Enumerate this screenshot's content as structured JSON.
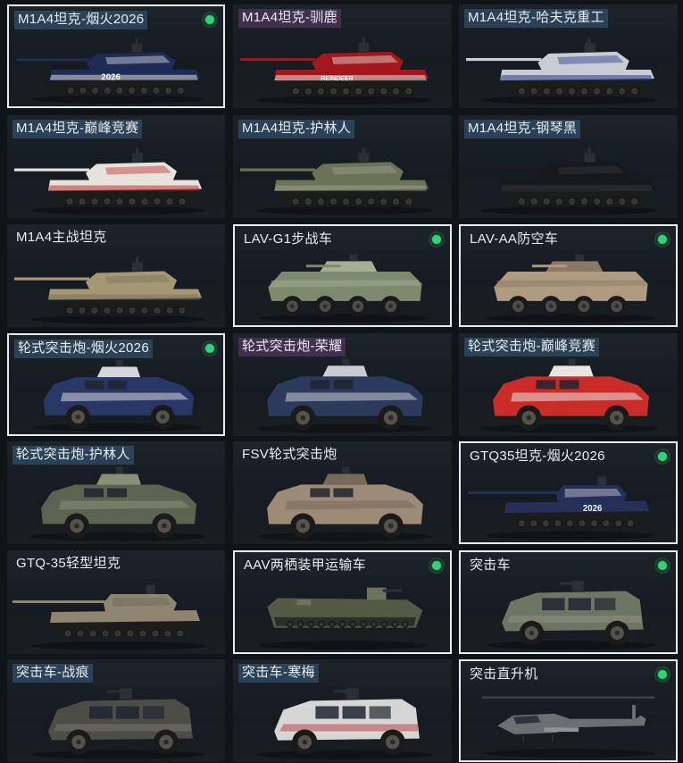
{
  "cards": [
    {
      "label": "M1A4坦克-烟火2026",
      "kind": "tank",
      "selected": true,
      "equipped": true,
      "title_bg": "blue",
      "hull": "#1f2b55",
      "accent": "#d9dbe3",
      "decal": "2026"
    },
    {
      "label": "M1A4坦克-驯鹿",
      "kind": "tank",
      "selected": false,
      "equipped": false,
      "title_bg": "purple",
      "hull": "#a2161c",
      "accent": "#e8e2d8",
      "decal": "REINDEER"
    },
    {
      "label": "M1A4坦克-哈夫克重工",
      "kind": "tank",
      "selected": false,
      "equipped": false,
      "title_bg": "blue",
      "hull": "#c9ccd3",
      "accent": "#2a3a8a",
      "decal": ""
    },
    {
      "label": "M1A4坦克-巅峰竞赛",
      "kind": "tank",
      "selected": false,
      "equipped": false,
      "title_bg": "blue",
      "hull": "#e6e2dd",
      "accent": "#c7302c",
      "decal": ""
    },
    {
      "label": "M1A4坦克-护林人",
      "kind": "tank",
      "selected": false,
      "equipped": false,
      "title_bg": "blue",
      "hull": "#6c7258",
      "accent": "#9ca08a",
      "decal": ""
    },
    {
      "label": "M1A4坦克-钢琴黑",
      "kind": "tank",
      "selected": false,
      "equipped": false,
      "title_bg": "blue",
      "hull": "#17181a",
      "accent": "#35373b",
      "decal": ""
    },
    {
      "label": "M1A4主战坦克",
      "kind": "tank",
      "selected": false,
      "equipped": false,
      "title_bg": "none",
      "hull": "#a59877",
      "accent": "#7d7358",
      "decal": ""
    },
    {
      "label": "LAV-G1步战车",
      "kind": "apc",
      "selected": true,
      "equipped": true,
      "title_bg": "none",
      "hull": "#7e8a6e",
      "accent": "#a6ae95",
      "decal": ""
    },
    {
      "label": "LAV-AA防空车",
      "kind": "apc",
      "selected": true,
      "equipped": true,
      "title_bg": "none",
      "hull": "#b09a80",
      "accent": "#8a7a64",
      "decal": ""
    },
    {
      "label": "轮式突击炮-烟火2026",
      "kind": "armored_car",
      "selected": true,
      "equipped": true,
      "title_bg": "blue",
      "hull": "#283866",
      "accent": "#d5d7de",
      "decal": ""
    },
    {
      "label": "轮式突击炮-荣耀",
      "kind": "armored_car",
      "selected": false,
      "equipped": false,
      "title_bg": "purple",
      "hull": "#2c3a5e",
      "accent": "#c9ccd2",
      "decal": ""
    },
    {
      "label": "轮式突击炮-巅峰竞赛",
      "kind": "armored_car",
      "selected": false,
      "equipped": false,
      "title_bg": "blue",
      "hull": "#cc2c28",
      "accent": "#e9e6e2",
      "decal": ""
    },
    {
      "label": "轮式突击炮-护林人",
      "kind": "armored_car",
      "selected": false,
      "equipped": false,
      "title_bg": "blue",
      "hull": "#5b6450",
      "accent": "#899078",
      "decal": ""
    },
    {
      "label": "FSV轮式突击炮",
      "kind": "armored_car",
      "selected": false,
      "equipped": false,
      "title_bg": "none",
      "hull": "#9c8b76",
      "accent": "#776a5b",
      "decal": ""
    },
    {
      "label": "GTQ35坦克-烟火2026",
      "kind": "light_tank",
      "selected": true,
      "equipped": true,
      "title_bg": "none",
      "hull": "#243058",
      "accent": "#d1d3da",
      "decal": "2026"
    },
    {
      "label": "GTQ-35轻型坦克",
      "kind": "light_tank",
      "selected": false,
      "equipped": false,
      "title_bg": "none",
      "hull": "#8d8570",
      "accent": "#6c6555",
      "decal": ""
    },
    {
      "label": "AAV两栖装甲运输车",
      "kind": "aav",
      "selected": true,
      "equipped": true,
      "title_bg": "none",
      "hull": "#545a45",
      "accent": "#6e745d",
      "decal": ""
    },
    {
      "label": "突击车",
      "kind": "mrap",
      "selected": true,
      "equipped": true,
      "title_bg": "none",
      "hull": "#6f7563",
      "accent": "#8f9482",
      "decal": ""
    },
    {
      "label": "突击车-战痕",
      "kind": "mrap",
      "selected": false,
      "equipped": false,
      "title_bg": "blue",
      "hull": "#4d4d48",
      "accent": "#7a7a70",
      "decal": ""
    },
    {
      "label": "突击车-寒梅",
      "kind": "mrap",
      "selected": false,
      "equipped": false,
      "title_bg": "blue",
      "hull": "#d6d6d4",
      "accent": "#b23a3a",
      "decal": ""
    },
    {
      "label": "突击直升机",
      "kind": "heli",
      "selected": true,
      "equipped": true,
      "title_bg": "none",
      "hull": "#6a6f72",
      "accent": "#8d9295",
      "decal": ""
    }
  ]
}
